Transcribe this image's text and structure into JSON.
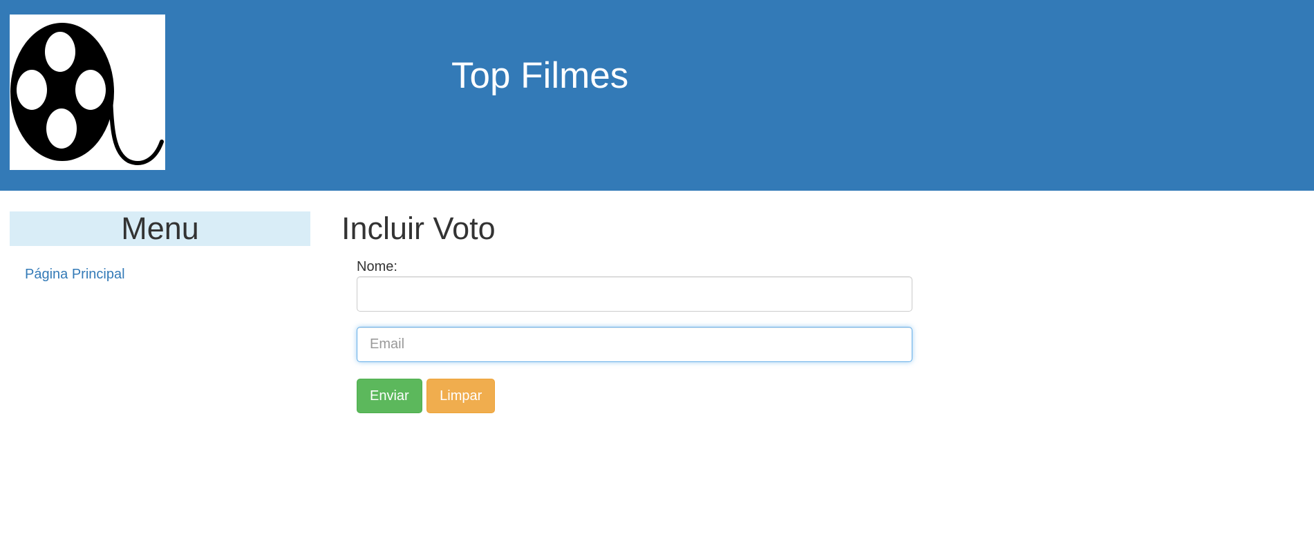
{
  "header": {
    "title": "Top Filmes",
    "logo_icon": "film-reel-icon",
    "background_color": "#337ab7"
  },
  "sidebar": {
    "heading": "Menu",
    "links": [
      {
        "label": "Página Principal"
      }
    ]
  },
  "main": {
    "title": "Incluir Voto",
    "form": {
      "name_label": "Nome:",
      "name_value": "",
      "email_placeholder": "Email",
      "email_value": "",
      "submit_label": "Enviar",
      "reset_label": "Limpar"
    }
  },
  "colors": {
    "link": "#337ab7",
    "menu_heading_bg": "#d9edf7",
    "submit_button": "#5cb85c",
    "reset_button": "#f0ad4e"
  }
}
